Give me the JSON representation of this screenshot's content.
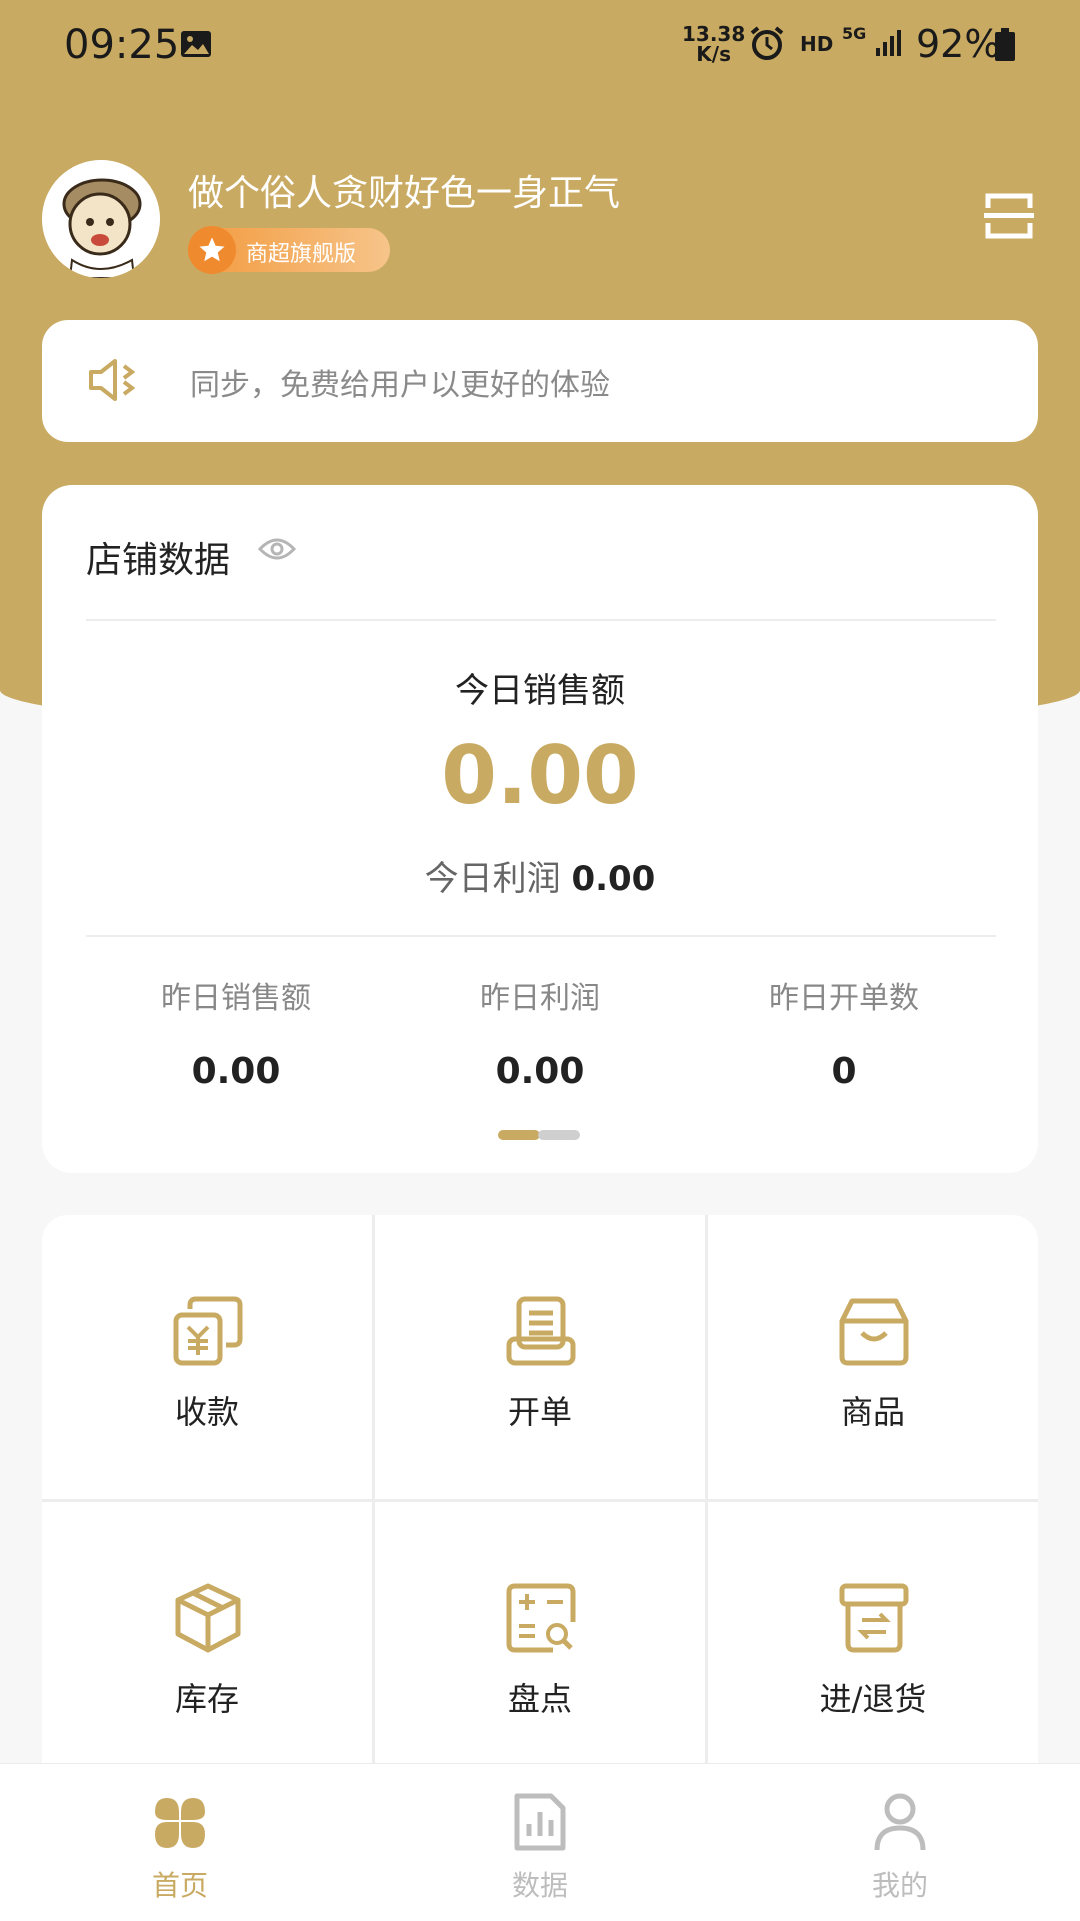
{
  "status_bar": {
    "time": "09:25",
    "net_speed_value": "13.38",
    "net_speed_unit": "K/s",
    "hd": "HD",
    "network": "5G",
    "battery": "92%"
  },
  "header": {
    "username": "做个俗人贪财好色一身正气",
    "badge": "商超旗舰版"
  },
  "notice": {
    "text": "同步，免费给用户以更好的体验"
  },
  "store": {
    "title": "店铺数据",
    "today_sales_label": "今日销售额",
    "today_sales_value": "0.00",
    "today_profit_label": "今日利润",
    "today_profit_value": "0.00",
    "yesterday": [
      {
        "label": "昨日销售额",
        "value": "0.00"
      },
      {
        "label": "昨日利润",
        "value": "0.00"
      },
      {
        "label": "昨日开单数",
        "value": "0"
      }
    ]
  },
  "actions": [
    {
      "label": "收款",
      "icon": "receive-payment-icon"
    },
    {
      "label": "开单",
      "icon": "create-order-icon"
    },
    {
      "label": "商品",
      "icon": "goods-icon"
    },
    {
      "label": "库存",
      "icon": "inventory-box-icon"
    },
    {
      "label": "盘点",
      "icon": "stocktake-icon"
    },
    {
      "label": "进/退货",
      "icon": "purchase-return-icon"
    }
  ],
  "tabs": [
    {
      "label": "首页",
      "icon": "home-icon",
      "active": true
    },
    {
      "label": "数据",
      "icon": "data-chart-icon",
      "active": false
    },
    {
      "label": "我的",
      "icon": "profile-icon",
      "active": false
    }
  ],
  "colors": {
    "accent": "#c9aa62",
    "inactive": "#bdbdbd",
    "badge": "#f39a3d"
  }
}
